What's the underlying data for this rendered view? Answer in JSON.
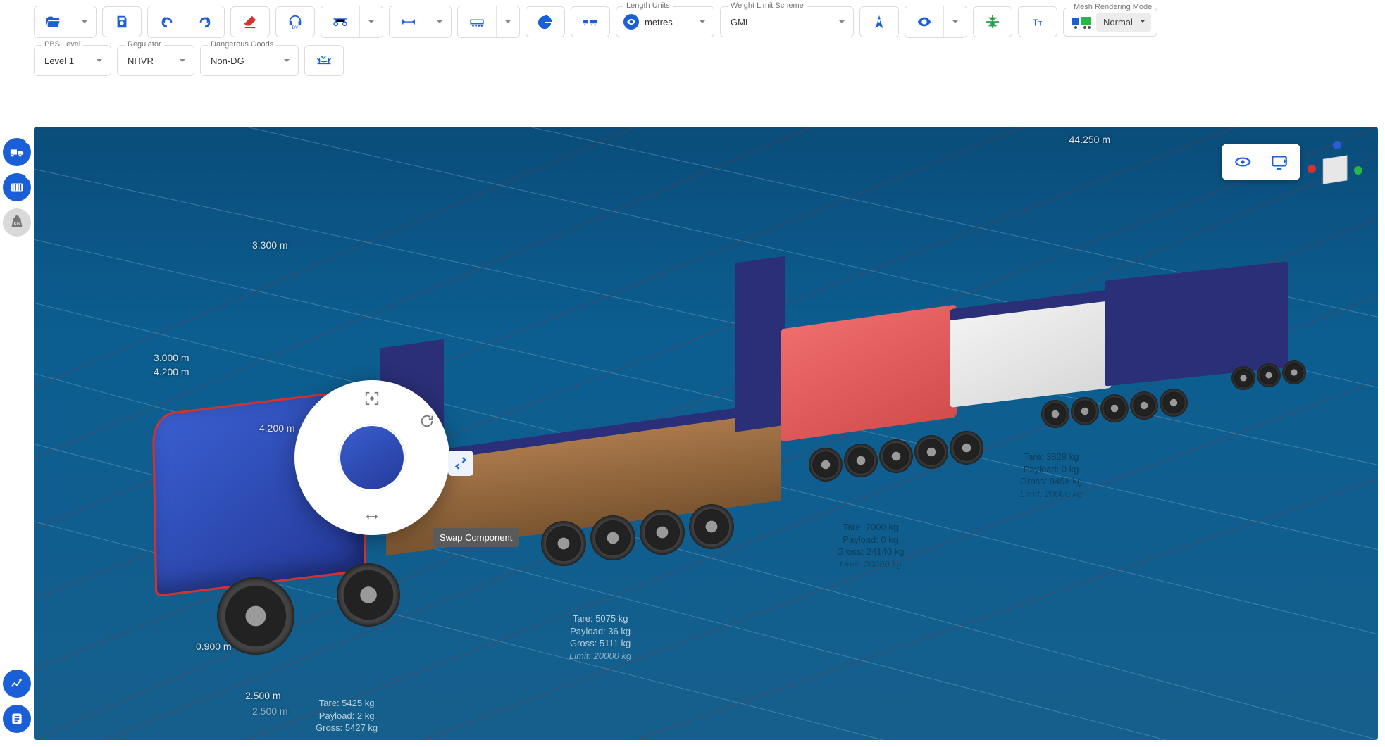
{
  "toolbar": {
    "length_units": {
      "label": "Length Units",
      "value": "metres"
    },
    "weight_scheme": {
      "label": "Weight Limit Scheme",
      "value": "GML"
    },
    "mesh_mode": {
      "label": "Mesh Rendering Mode",
      "value": "Normal"
    }
  },
  "toolbar2": {
    "pbs_level": {
      "label": "PBS Level",
      "value": "Level 1"
    },
    "regulator": {
      "label": "Regulator",
      "value": "NHVR"
    },
    "dangerous_goods": {
      "label": "Dangerous Goods",
      "value": "Non-DG"
    }
  },
  "radial_tooltip": "Swap Component",
  "dimensions": {
    "overall_length": "44.250 m",
    "d1": "3.300 m",
    "d2": "3.000 m",
    "d3": "4.200 m",
    "d4": "4.200 m",
    "d5": "0.900 m",
    "d6": "2.500 m",
    "d7": "2.500 m"
  },
  "mass_blocks": {
    "front_axle": {
      "tare": "Tare: 5425 kg",
      "payload": "Payload: 2 kg",
      "gross": "Gross: 5427 kg"
    },
    "group1": {
      "tare": "Tare: 5075 kg",
      "payload": "Payload: 36 kg",
      "gross": "Gross: 5111 kg",
      "limit": "Limit: 20000 kg"
    },
    "group2": {
      "tare": "Tare: 7000 kg",
      "payload": "Payload: 0 kg",
      "gross": "Gross: 24140 kg",
      "limit": "Limit: 20000 kg"
    },
    "group3": {
      "tare": "Tare: 3828 kg",
      "payload": "Payload: 0 kg",
      "gross": "Gross: 9498 kg",
      "limit": "Limit: 20000 kg"
    }
  }
}
